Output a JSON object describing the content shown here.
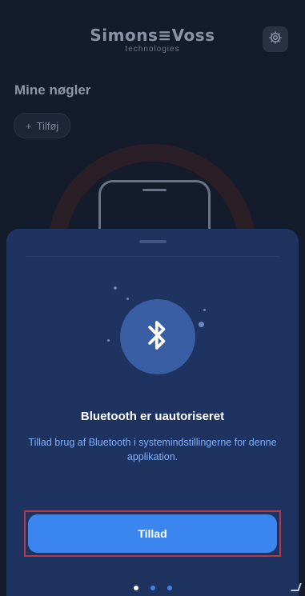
{
  "header": {
    "brand_name": "Simons≡Voss",
    "brand_sub": "technologies",
    "settings_icon": "gear-icon"
  },
  "page": {
    "title": "Mine nøgler",
    "add_button": {
      "icon": "plus-icon",
      "label": "Tilføj"
    }
  },
  "sheet": {
    "icon": "bluetooth-icon",
    "title": "Bluetooth er uautoriseret",
    "description": "Tillad brug af Bluetooth i systemindstillingerne for denne applikation.",
    "allow_button": "Tillad",
    "pager": {
      "count": 3,
      "active_index": 0
    }
  },
  "colors": {
    "background": "#141b2a",
    "sheet": "#1e3360",
    "accent": "#3a86ee",
    "highlight_border": "#b23a4d",
    "description_text": "#7fb0ff"
  }
}
